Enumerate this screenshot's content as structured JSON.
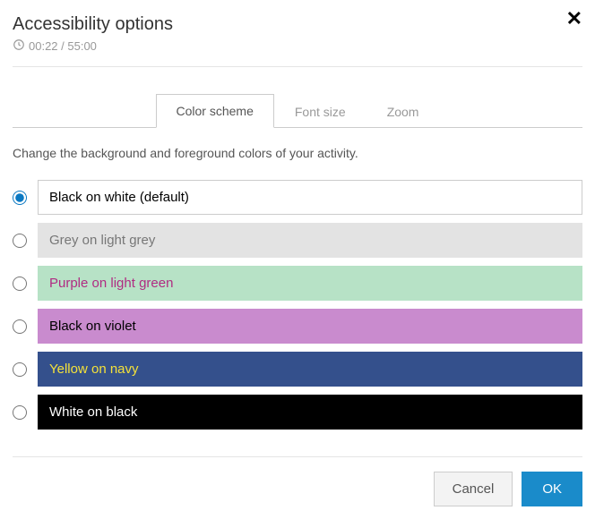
{
  "header": {
    "title": "Accessibility options",
    "timer": "00:22 / 55:00"
  },
  "tabs": {
    "items": [
      {
        "label": "Color scheme",
        "active": true
      },
      {
        "label": "Font size",
        "active": false
      },
      {
        "label": "Zoom",
        "active": false
      }
    ]
  },
  "description": "Change the background and foreground colors of your activity.",
  "color_options": [
    {
      "label": "Black on white (default)",
      "fg": "#000000",
      "bg": "#ffffff",
      "border": "#cccccc",
      "selected": true
    },
    {
      "label": "Grey on light grey",
      "fg": "#777777",
      "bg": "#e3e3e3",
      "border": "#e3e3e3",
      "selected": false
    },
    {
      "label": "Purple on light green",
      "fg": "#b02b82",
      "bg": "#b7e2c6",
      "border": "#b7e2c6",
      "selected": false
    },
    {
      "label": "Black on violet",
      "fg": "#000000",
      "bg": "#c98bce",
      "border": "#c98bce",
      "selected": false
    },
    {
      "label": "Yellow on navy",
      "fg": "#f4e13a",
      "bg": "#34508c",
      "border": "#34508c",
      "selected": false
    },
    {
      "label": "White on black",
      "fg": "#ffffff",
      "bg": "#000000",
      "border": "#000000",
      "selected": false
    }
  ],
  "footer": {
    "cancel": "Cancel",
    "ok": "OK"
  }
}
